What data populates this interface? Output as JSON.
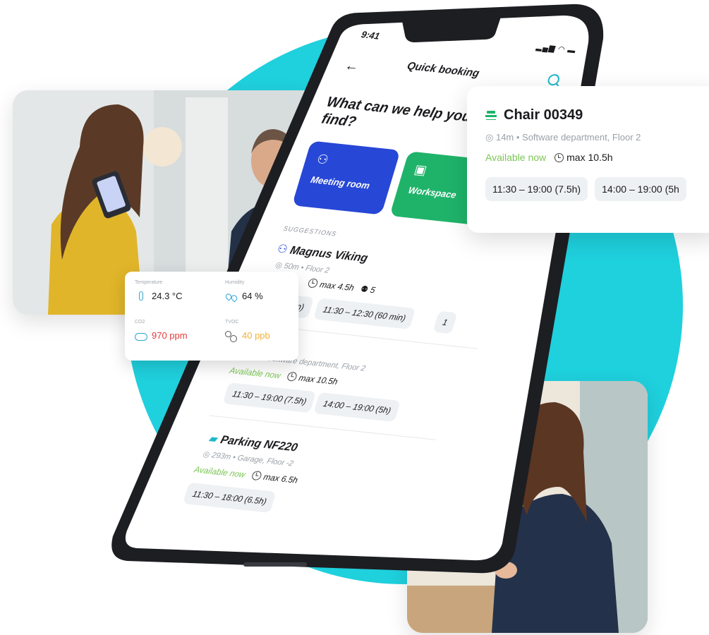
{
  "phone": {
    "status_time": "9:41",
    "screen_title": "Quick booking",
    "headline": "What can we help you find?",
    "tiles": [
      {
        "label": "Meeting room",
        "icon": "meeting-room-icon",
        "color": "#2747d6"
      },
      {
        "label": "Workspace",
        "icon": "workspace-icon",
        "color": "#1fb36a"
      }
    ],
    "suggestions_heading": "SUGGESTIONS",
    "items": [
      {
        "title": "Magnus Viking",
        "icon": "meeting-room-icon",
        "meta": "50m • Floor 2",
        "max": "max 4.5h",
        "capacity": "5",
        "chips": [
          "30 min)",
          "11:30 – 12:30 (60 min)",
          "1"
        ]
      },
      {
        "meta": "14m • Software department, Floor 2",
        "availability": "Available now",
        "max": "max 10.5h",
        "chips": [
          "11:30 – 19:00 (7.5h)",
          "14:00 – 19:00 (5h)"
        ]
      },
      {
        "title": "Parking NF220",
        "icon": "car-icon",
        "meta": "293m • Garage, Floor -2",
        "availability": "Available now",
        "max": "max 6.5h",
        "chips": [
          "11:30 – 18:00 (6.5h)"
        ]
      }
    ]
  },
  "chair_card": {
    "title": "Chair 00349",
    "meta": "14m • Software department, Floor 2",
    "availability": "Available now",
    "max": "max 10.5h",
    "chips": [
      "11:30 – 19:00 (7.5h)",
      "14:00 – 19:00 (5h"
    ]
  },
  "env_card": {
    "temperature": {
      "label": "Temperature",
      "value": "24.3 °C"
    },
    "humidity": {
      "label": "Humidity",
      "value": "64 %"
    },
    "co2": {
      "label": "CO2",
      "value": "970 ppm",
      "color": "#e53b3b"
    },
    "tvoc": {
      "label": "TVOC",
      "value": "40 ppb",
      "color": "#f2b13c"
    }
  },
  "colors": {
    "accent_teal": "#1fd0dd",
    "available_green": "#7bc655",
    "meeting_blue": "#2747d6",
    "workspace_green": "#1fb36a"
  }
}
